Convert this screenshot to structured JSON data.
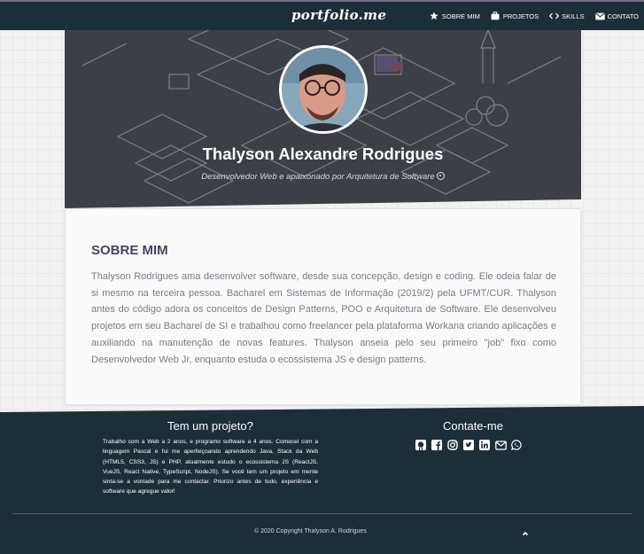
{
  "nav": {
    "brand": "portfolio.me",
    "items": [
      {
        "label": "SOBRE MIM",
        "icon": "star-icon"
      },
      {
        "label": "PROJETOS",
        "icon": "briefcase-icon"
      },
      {
        "label": "SKILLS",
        "icon": "code-icon"
      },
      {
        "label": "CONTATO",
        "icon": "envelope-icon"
      }
    ]
  },
  "hero": {
    "name": "Thalyson Alexandre Rodrigues",
    "subtitle": "Desenvolvedor Web e apaixonado por Arquitetura de Software"
  },
  "about": {
    "title": "SOBRE MIM",
    "text": "Thalyson Rodrigues ama desenvolver software, desde sua concepção, design e coding. Ele odeia falar de si mesmo na terceira pessoa. Bacharel em Sistemas de Informação (2019/2) pela UFMT/CUR. Thalyson antes do código adora os conceitos de Design Patterns, POO e Arquitetura de Software. Ele desenvolveu projetos em seu Bacharel de SI e trabalhou como freelancer pela plataforma Workana criando aplicações e auxiliando na manutenção de novas features. Thalyson anseia pelo seu primeiro \"job\" fixo como Desenvolvedor Web Jr, enquanto estuda o ecossistema JS e design patterns."
  },
  "footer": {
    "project_title": "Tem um projeto?",
    "project_text": "Trabalho com a Web a 2 anos, e programo software a 4 anos. Comecei com a linguagem Pascal e fui me aperfeiçoando aprendendo Java, Stack da Web (HTML5, CSS3, JS) e PHP, atualmente estudo o ecossistema JS (ReactJS, VueJS, React Native, TypeScript, NodeJS). Se você tem um projeto em mente sinta-se a vontade para me contactar. Priorizo antes de tudo, experiência e software que agregue valor!",
    "contact_title": "Contate-me",
    "socials": [
      "github-icon",
      "facebook-icon",
      "instagram-icon",
      "twitter-icon",
      "linkedin-icon",
      "email-icon",
      "whatsapp-icon"
    ],
    "copyright": "© 2020 Copyright Thalyson A. Rodrigues"
  },
  "colors": {
    "navbar": "#1b2f38",
    "about_title": "#4a3f66",
    "body_text": "#7a7a88"
  }
}
